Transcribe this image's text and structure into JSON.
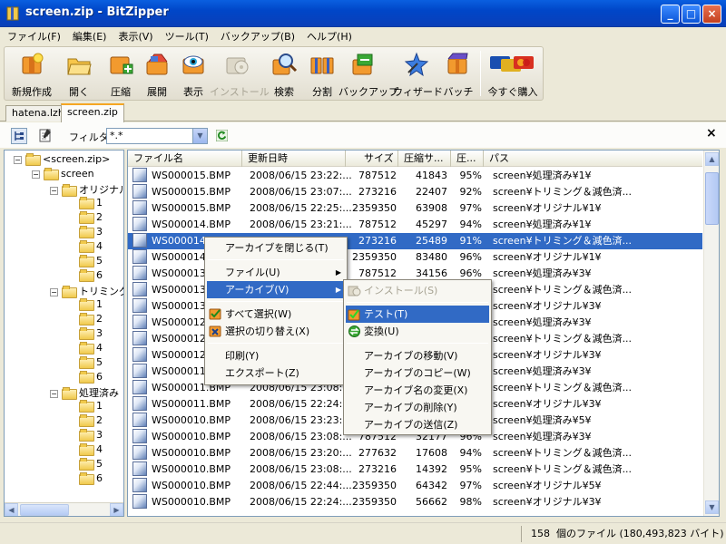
{
  "window": {
    "title": "screen.zip - BitZipper",
    "min": "_",
    "max": "□",
    "close": "×"
  },
  "menubar": [
    "ファイル(F)",
    "編集(E)",
    "表示(V)",
    "ツール(T)",
    "バックアップ(B)",
    "ヘルプ(H)"
  ],
  "toolbar": [
    {
      "label": "新規作成",
      "icon": "new-archive-icon"
    },
    {
      "label": "開く",
      "icon": "open-folder-icon"
    },
    {
      "label": "圧縮",
      "icon": "compress-icon"
    },
    {
      "label": "展開",
      "icon": "extract-icon"
    },
    {
      "label": "表示",
      "icon": "view-eye-icon"
    },
    {
      "label": "インストール",
      "icon": "install-icon",
      "disabled": true
    },
    {
      "label": "検索",
      "icon": "search-icon"
    },
    {
      "label": "分割",
      "icon": "split-icon"
    },
    {
      "label": "バックアップ",
      "icon": "backup-icon"
    },
    {
      "label": "ウィザード",
      "icon": "wizard-icon"
    },
    {
      "label": "バッチ",
      "icon": "batch-icon"
    },
    {
      "label": "今すぐ購入",
      "icon": "credit-cards-icon"
    }
  ],
  "tabs": [
    {
      "label": "hatena.lzh"
    },
    {
      "label": "screen.zip",
      "active": true
    }
  ],
  "filter": {
    "label": "フィルタ:",
    "value": "*.*",
    "close": "×"
  },
  "tree": [
    {
      "label": "<screen.zip>",
      "toggle": "−"
    },
    {
      "label": "screen",
      "toggle": "−"
    },
    {
      "label": "オリジナル",
      "toggle": "−"
    },
    {
      "label": "1"
    },
    {
      "label": "2"
    },
    {
      "label": "3"
    },
    {
      "label": "4"
    },
    {
      "label": "5"
    },
    {
      "label": "6"
    },
    {
      "label": "トリミング&",
      "toggle": "−"
    },
    {
      "label": "1"
    },
    {
      "label": "2"
    },
    {
      "label": "3"
    },
    {
      "label": "4"
    },
    {
      "label": "5"
    },
    {
      "label": "6"
    },
    {
      "label": "処理済み",
      "toggle": "−"
    },
    {
      "label": "1"
    },
    {
      "label": "2"
    },
    {
      "label": "3"
    },
    {
      "label": "4"
    },
    {
      "label": "5"
    },
    {
      "label": "6"
    }
  ],
  "columns": [
    "ファイル名",
    "更新日時",
    "サイズ",
    "圧縮サ...",
    "圧...",
    "パス"
  ],
  "rows": [
    {
      "name": "WS000015.BMP",
      "date": "2008/06/15 23:22:...",
      "size": "787512",
      "csize": "41843",
      "ratio": "95%",
      "path": "screen¥処理済み¥1¥"
    },
    {
      "name": "WS000015.BMP",
      "date": "2008/06/15 23:07:...",
      "size": "273216",
      "csize": "22407",
      "ratio": "92%",
      "path": "screen¥トリミング＆減色済..."
    },
    {
      "name": "WS000015.BMP",
      "date": "2008/06/15 22:25:...",
      "size": "2359350",
      "csize": "63908",
      "ratio": "97%",
      "path": "screen¥オリジナル¥1¥"
    },
    {
      "name": "WS000014.BMP",
      "date": "2008/06/15 23:21:...",
      "size": "787512",
      "csize": "45297",
      "ratio": "94%",
      "path": "screen¥処理済み¥1¥"
    },
    {
      "name": "WS000014.",
      "date": "",
      "size": "273216",
      "csize": "25489",
      "ratio": "91%",
      "path": "screen¥トリミング＆減色済...",
      "selected": true
    },
    {
      "name": "WS000014.",
      "date": "",
      "size": "2359350",
      "csize": "83480",
      "ratio": "96%",
      "path": "screen¥オリジナル¥1¥"
    },
    {
      "name": "WS000013.",
      "date": "",
      "size": "787512",
      "csize": "34156",
      "ratio": "96%",
      "path": "screen¥処理済み¥3¥"
    },
    {
      "name": "WS000013.",
      "date": "",
      "size": "",
      "csize": "",
      "ratio": "",
      "path": "screen¥トリミング＆減色済..."
    },
    {
      "name": "WS000013.",
      "date": "",
      "size": "",
      "csize": "",
      "ratio": "",
      "path": "screen¥オリジナル¥3¥"
    },
    {
      "name": "WS000012.",
      "date": "",
      "size": "",
      "csize": "",
      "ratio": "",
      "path": "screen¥処理済み¥3¥"
    },
    {
      "name": "WS000012.",
      "date": "",
      "size": "",
      "csize": "",
      "ratio": "",
      "path": "screen¥トリミング＆減色済..."
    },
    {
      "name": "WS000012.",
      "date": "",
      "size": "",
      "csize": "",
      "ratio": "",
      "path": "screen¥オリジナル¥3¥"
    },
    {
      "name": "WS000011.",
      "date": "",
      "size": "",
      "csize": "",
      "ratio": "",
      "path": "screen¥処理済み¥3¥"
    },
    {
      "name": "WS000011.BMP",
      "date": "2008/06/15 23:08:...",
      "size": "",
      "csize": "",
      "ratio": "",
      "path": "screen¥トリミング＆減色済..."
    },
    {
      "name": "WS000011.BMP",
      "date": "2008/06/15 22:24:...",
      "size": "",
      "csize": "",
      "ratio": "",
      "path": "screen¥オリジナル¥3¥"
    },
    {
      "name": "WS000010.BMP",
      "date": "2008/06/15 23:23:...",
      "size": "",
      "csize": "",
      "ratio": "",
      "path": "screen¥処理済み¥5¥"
    },
    {
      "name": "WS000010.BMP",
      "date": "2008/06/15 23:08:...",
      "size": "787512",
      "csize": "32177",
      "ratio": "96%",
      "path": "screen¥処理済み¥3¥"
    },
    {
      "name": "WS000010.BMP",
      "date": "2008/06/15 23:20:...",
      "size": "277632",
      "csize": "17608",
      "ratio": "94%",
      "path": "screen¥トリミング＆減色済..."
    },
    {
      "name": "WS000010.BMP",
      "date": "2008/06/15 23:08:...",
      "size": "273216",
      "csize": "14392",
      "ratio": "95%",
      "path": "screen¥トリミング＆減色済..."
    },
    {
      "name": "WS000010.BMP",
      "date": "2008/06/15 22:44:...",
      "size": "2359350",
      "csize": "64342",
      "ratio": "97%",
      "path": "screen¥オリジナル¥5¥"
    },
    {
      "name": "WS000010.BMP",
      "date": "2008/06/15 22:24:...",
      "size": "2359350",
      "csize": "56662",
      "ratio": "98%",
      "path": "screen¥オリジナル¥3¥"
    }
  ],
  "status": {
    "count": "158",
    "summary": "個のファイル (180,493,823 バイト)"
  },
  "context_menu": {
    "items": [
      {
        "label": "アーカイブを閉じる(T)"
      },
      {
        "label": "ファイル(U)",
        "sub": true
      },
      {
        "label": "アーカイブ(V)",
        "sub": true,
        "highlight": true
      },
      {
        "label": "すべて選択(W)",
        "icon": "select-all-icon"
      },
      {
        "label": "選択の切り替え(X)",
        "icon": "toggle-selection-icon"
      },
      {
        "label": "印刷(Y)"
      },
      {
        "label": "エクスポート(Z)"
      }
    ]
  },
  "submenu": {
    "items": [
      {
        "label": "インストール(S)",
        "disabled": true,
        "icon": "install-icon"
      },
      {
        "label": "テスト(T)",
        "highlight": true,
        "icon": "test-icon"
      },
      {
        "label": "変換(U)",
        "icon": "convert-icon"
      },
      {
        "label": "アーカイブの移動(V)"
      },
      {
        "label": "アーカイブのコピー(W)"
      },
      {
        "label": "アーカイブ名の変更(X)"
      },
      {
        "label": "アーカイブの削除(Y)"
      },
      {
        "label": "アーカイブの送信(Z)"
      }
    ]
  }
}
